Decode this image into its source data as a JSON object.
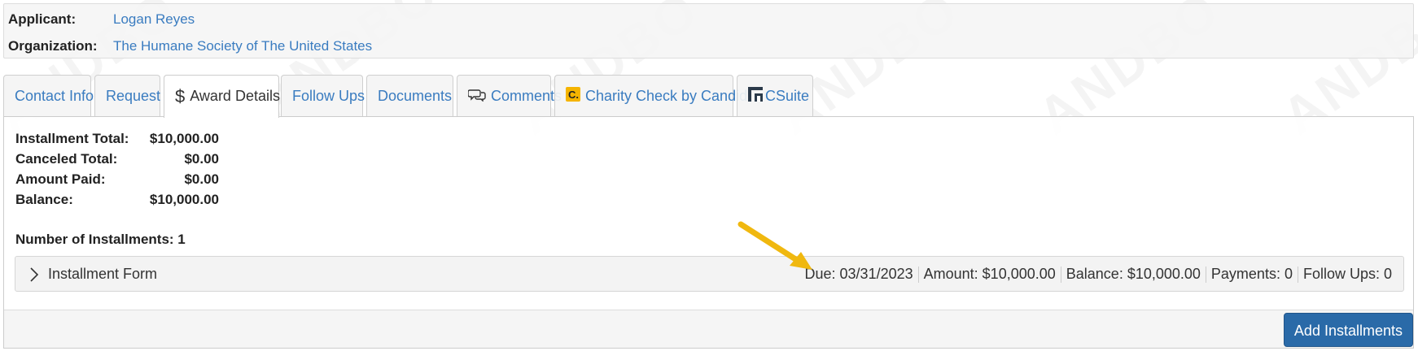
{
  "header": {
    "applicant_label": "Applicant:",
    "applicant_value": "Logan Reyes",
    "organization_label": "Organization:",
    "organization_value": "The Humane Society of The United States"
  },
  "tabs": [
    {
      "label": "Contact Info",
      "icon": null,
      "active": false
    },
    {
      "label": "Request",
      "icon": null,
      "active": false
    },
    {
      "label": "Award Details",
      "icon": "dollar-icon",
      "active": true
    },
    {
      "label": "Follow Ups",
      "icon": null,
      "active": false
    },
    {
      "label": "Documents",
      "icon": null,
      "active": false
    },
    {
      "label": "Comments",
      "icon": "comments-icon",
      "active": false
    },
    {
      "label": "Charity Check by Candid",
      "icon": "candid-logo-icon",
      "active": false
    },
    {
      "label": "CSuite",
      "icon": "csuite-logo-icon",
      "active": false
    }
  ],
  "award": {
    "installment_total_label": "Installment Total:",
    "installment_total_value": "$10,000.00",
    "canceled_total_label": "Canceled Total:",
    "canceled_total_value": "$0.00",
    "amount_paid_label": "Amount Paid:",
    "amount_paid_value": "$0.00",
    "balance_label": "Balance:",
    "balance_value": "$10,000.00",
    "number_of_installments": "Number of Installments: 1"
  },
  "installment": {
    "title": "Installment Form",
    "due": "Due: 03/31/2023",
    "amount": "Amount: $10,000.00",
    "balance": "Balance: $10,000.00",
    "payments": "Payments: 0",
    "follow_ups": "Follow Ups: 0"
  },
  "actions": {
    "add_installments_label": "Add Installments"
  },
  "colors": {
    "link": "#3a7cc0",
    "primary_button": "#2a6aa8",
    "arrow_annotation": "#f0b80f",
    "candid_logo": "#f5b400"
  }
}
